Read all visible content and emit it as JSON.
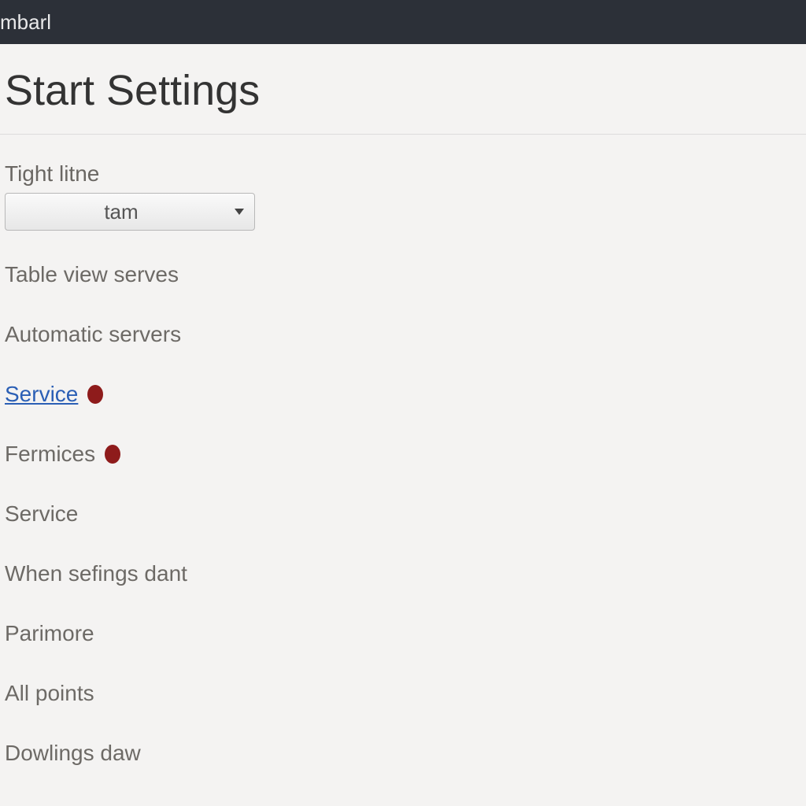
{
  "topbar": {
    "title": "mbarl"
  },
  "page": {
    "title": "Start Settings"
  },
  "dropdown": {
    "label": "Tight litne",
    "value": "tam"
  },
  "list": {
    "items": [
      {
        "label": "Table view serves",
        "link": false,
        "dot": false
      },
      {
        "label": "Automatic servers",
        "link": false,
        "dot": false
      },
      {
        "label": "Service",
        "link": true,
        "dot": true
      },
      {
        "label": "Fermices",
        "link": false,
        "dot": true
      },
      {
        "label": "Service",
        "link": false,
        "dot": false
      },
      {
        "label": "When sefings dant",
        "link": false,
        "dot": false
      },
      {
        "label": "Parimore",
        "link": false,
        "dot": false
      },
      {
        "label": "All points",
        "link": false,
        "dot": false
      },
      {
        "label": "Dowlings daw",
        "link": false,
        "dot": false
      }
    ]
  },
  "colors": {
    "topbar_bg": "#2c3038",
    "link": "#2b5fb5",
    "dot": "#8e1b1b"
  }
}
